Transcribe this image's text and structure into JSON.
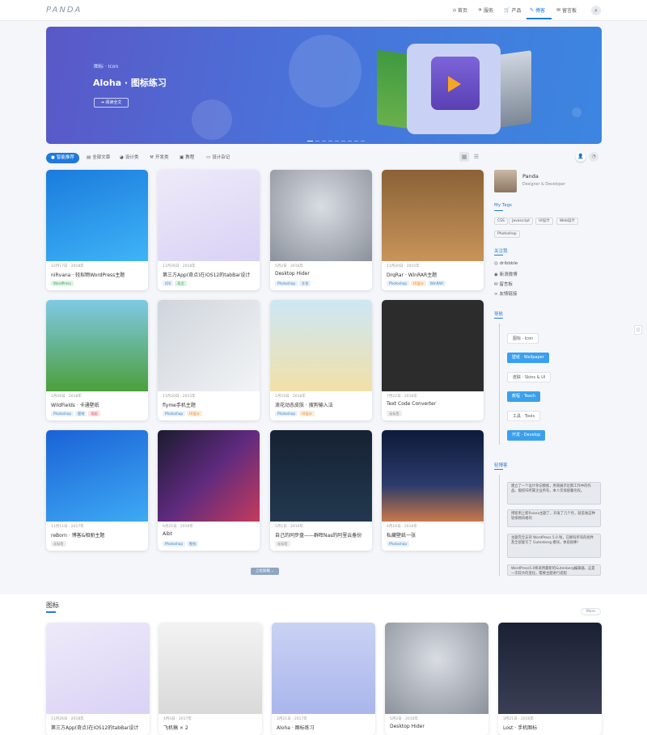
{
  "header": {
    "logo": "PANDA",
    "nav": [
      {
        "label": "首页",
        "icon": "home-icon"
      },
      {
        "label": "服务",
        "icon": "plane-icon"
      },
      {
        "label": "产品",
        "icon": "cart-icon"
      },
      {
        "label": "博客",
        "icon": "edit-icon",
        "active": true
      },
      {
        "label": "留言板",
        "icon": "message-icon"
      }
    ]
  },
  "hero": {
    "category": "图标 · Icon",
    "title": "Aloha · 图标练习",
    "button": "阅读全文"
  },
  "tabs": [
    "智能推荐",
    "全部文章",
    "设计类",
    "开发类",
    "教程",
    "设计杂记"
  ],
  "posts": [
    {
      "meta": "12月17日 · 2018年",
      "title": "niRvana · 轻拟物WordPress主题",
      "tags": [
        {
          "t": "WordPress",
          "c": "green"
        }
      ]
    },
    {
      "meta": "11月26日 · 2018年",
      "title": "第三方App(奇点)在iOS12的tabBar设计",
      "tags": [
        {
          "t": "iOS",
          "c": "blue"
        },
        {
          "t": "奇点",
          "c": "green"
        }
      ]
    },
    {
      "meta": "5月2日 · 2016年",
      "title": "Desktop Hider",
      "tags": [
        {
          "t": "Photoshop",
          "c": "blue"
        },
        {
          "t": "开发",
          "c": "blue"
        }
      ]
    },
    {
      "meta": "11月20日 · 2015年",
      "title": "DrqRar · WinRAR主题",
      "tags": [
        {
          "t": "Photoshop",
          "c": "blue"
        },
        {
          "t": "UI设计",
          "c": "orange"
        },
        {
          "t": "WinRAR",
          "c": "blue"
        }
      ]
    },
    {
      "meta": "1月26日 · 2018年",
      "title": "WildFields · 卡通壁纸",
      "tags": [
        {
          "t": "Photoshop",
          "c": "blue"
        },
        {
          "t": "壁纸",
          "c": "blue"
        },
        {
          "t": "插画",
          "c": "pink"
        }
      ]
    },
    {
      "meta": "11月20日 · 2015年",
      "title": "flyme手机主题",
      "tags": [
        {
          "t": "Photoshop",
          "c": "blue"
        },
        {
          "t": "UI设计",
          "c": "orange"
        }
      ]
    },
    {
      "meta": "1月19日 · 2016年",
      "title": "浪花动态皮肤 · 搜狗输入法",
      "tags": [
        {
          "t": "Photoshop",
          "c": "blue"
        },
        {
          "t": "UI设计",
          "c": "orange"
        }
      ]
    },
    {
      "meta": "7月22日 · 2016年",
      "title": "Text Code Converter",
      "tags": [
        {
          "t": "无标签",
          "c": "gray"
        }
      ]
    },
    {
      "meta": "11月11日 · 2017年",
      "title": "reBorn · 博客&相册主题",
      "tags": [
        {
          "t": "无标签",
          "c": "gray"
        }
      ]
    },
    {
      "meta": "6月25日 · 2016年",
      "title": "Aibt",
      "tags": [
        {
          "t": "Photoshop",
          "c": "blue"
        },
        {
          "t": "壁纸",
          "c": "blue"
        }
      ]
    },
    {
      "meta": "5月1日 · 2016年",
      "title": "自己的同步盘——群晖Nas的阿里云备份",
      "tags": [
        {
          "t": "无标签",
          "c": "gray"
        }
      ]
    },
    {
      "meta": "4月16日 · 2016年",
      "title": "私藏壁纸一张",
      "tags": [
        {
          "t": "Photoshop",
          "c": "blue"
        }
      ]
    }
  ],
  "load_more": "上拉加载",
  "sidebar": {
    "profile": {
      "name": "Panda",
      "role": "Designer & Developer"
    },
    "tags_title": "My Tags",
    "tags": [
      "CSS",
      "Javascript",
      "UI设计",
      "Web设计",
      "Photoshop"
    ],
    "follow_title": "关注我",
    "follow": [
      "dribbble",
      "新浪微博",
      "留言板",
      "友情链接"
    ],
    "nav_title": "导航",
    "nav_items": [
      "图标 · Icon",
      "壁纸 · Wallpaper",
      "皮肤 · Skins & UI",
      "教程 · Teach",
      "工具 · Tools",
      "开发 · Develop"
    ],
    "blog_title": "轻博客",
    "blog_notes": [
      "建立了一个设计杂记模板，用来展示近期工作中的作品。版权归所属企业所有，本人仅保留署名权。",
      "博客用上新Rvana主题了，开发了几个月，就差收这种轻拟物风格的",
      "主题完全支持 WordPress 5.0 啦，已拥有所有的组件及全部复写了 Gutenberg 模块，体验很棒！",
      "WordPress5.0将采用最新的Gutenberg编辑器，这是一次较大的变化，需要主题进行适配"
    ]
  },
  "section2": {
    "title": "图标",
    "more": "More",
    "items": [
      {
        "meta": "11月26日 · 2018年",
        "title": "第三方App(奇点)在iOS12的tabBar设计"
      },
      {
        "meta": "4月4日 · 2017年",
        "title": "飞机稿 × 2"
      },
      {
        "meta": "2月21日 · 2017年",
        "title": "Aloha · 图标练习"
      },
      {
        "meta": "5月2日 · 2016年",
        "title": "Desktop Hider"
      },
      {
        "meta": "3月21日 · 2016年",
        "title": "Lost · 手机图标"
      }
    ]
  }
}
